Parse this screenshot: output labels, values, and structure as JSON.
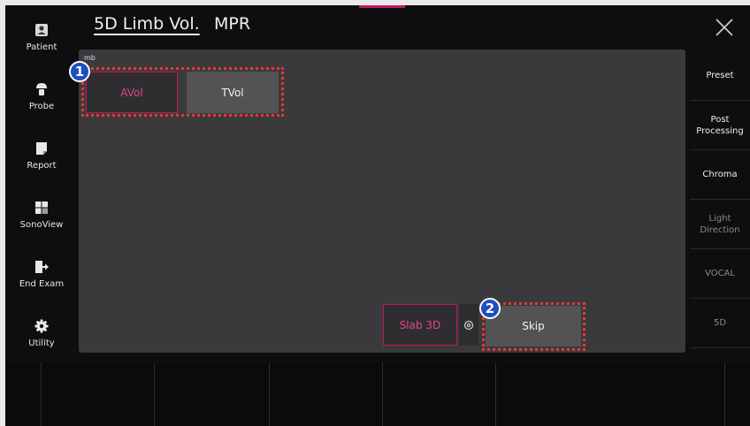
{
  "header": {
    "tabs": [
      {
        "label": "5D Limb Vol.",
        "active": true
      },
      {
        "label": "MPR",
        "active": false
      }
    ],
    "accent_color": "#c2185b"
  },
  "sidebar": {
    "items": [
      {
        "label": "Patient",
        "icon": "patient-icon"
      },
      {
        "label": "Probe",
        "icon": "probe-icon"
      },
      {
        "label": "Report",
        "icon": "report-icon"
      },
      {
        "label": "SonoView",
        "icon": "sonoview-icon"
      },
      {
        "label": "End Exam",
        "icon": "end-exam-icon"
      },
      {
        "label": "Utility",
        "icon": "gear-icon"
      }
    ]
  },
  "panel": {
    "label": "mb",
    "avol_label": "AVol",
    "tvol_label": "TVol",
    "slab_label": "Slab 3D",
    "skip_label": "Skip",
    "badge1": "1",
    "badge2": "2"
  },
  "right": {
    "items": [
      {
        "label": "Preset",
        "enabled": true
      },
      {
        "label": "Post Processing",
        "enabled": true
      },
      {
        "label": "Chroma",
        "enabled": true
      },
      {
        "label": "Light Direction",
        "enabled": false
      },
      {
        "label": "VOCAL",
        "enabled": false
      },
      {
        "label": "5D",
        "enabled": false
      }
    ]
  },
  "colors": {
    "highlight": "#e53935",
    "badge": "#1e4fbf",
    "active_text": "#e8418a"
  }
}
